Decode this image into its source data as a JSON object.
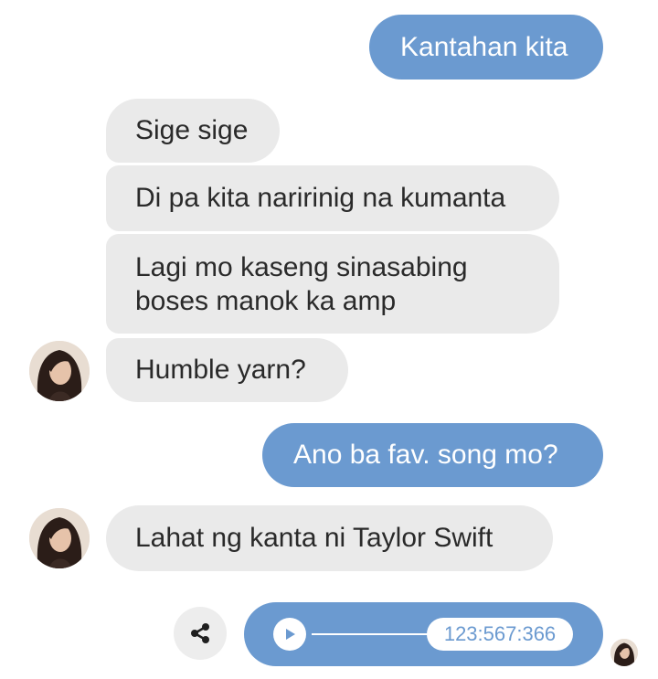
{
  "messages": {
    "m1": "Kantahan kita",
    "m2": "Sige sige",
    "m3": "Di pa kita naririnig na kumanta",
    "m4_line1": "Lagi mo kaseng sinasabing",
    "m4_line2": "boses manok ka amp",
    "m5": "Humble yarn?",
    "m6": "Ano ba fav. song mo?",
    "m7": "Lahat ng kanta ni Taylor Swift"
  },
  "audio": {
    "time_label": "123:567:366"
  },
  "icons": {
    "share": "share-icon",
    "play": "play-icon"
  },
  "colors": {
    "outgoing": "#6b9ad0",
    "incoming": "#eaeaea"
  }
}
